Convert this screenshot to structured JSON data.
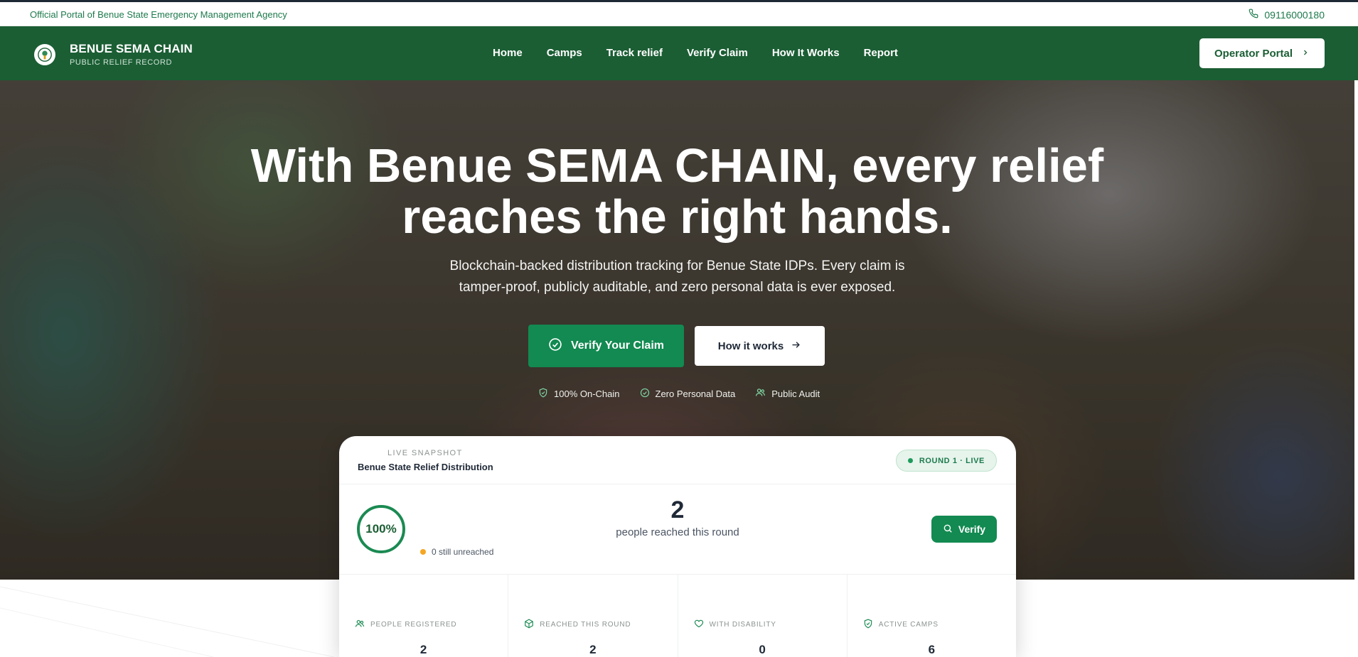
{
  "topbar": {
    "official_text": "Official Portal of Benue State Emergency Management Agency",
    "phone": "09116000180"
  },
  "brand": {
    "title": "BENUE SEMA CHAIN",
    "subtitle": "PUBLIC RELIEF RECORD"
  },
  "nav": {
    "items": [
      "Home",
      "Camps",
      "Track relief",
      "Verify Claim",
      "How It Works",
      "Report"
    ],
    "operator_label": "Operator Portal"
  },
  "hero": {
    "title_line1": "With Benue SEMA CHAIN, every relief",
    "title_line2": "reaches the right hands.",
    "subtitle": "Blockchain-backed distribution tracking for Benue State IDPs. Every claim is tamper-proof, publicly auditable, and zero personal data is ever exposed.",
    "primary_cta": "Verify Your Claim",
    "secondary_cta": "How it works",
    "badges": [
      "100% On-Chain",
      "Zero Personal Data",
      "Public Audit"
    ]
  },
  "snapshot": {
    "label": "LIVE SNAPSHOT",
    "title": "Benue State Relief Distribution",
    "round_status": "ROUND 1 · LIVE",
    "percent_reached": "100%",
    "unreached_text": "0 still unreached",
    "reached_count": "2",
    "reached_caption": "people reached this round",
    "verify_label": "Verify"
  },
  "stats": [
    {
      "icon": "people-icon",
      "label": "PEOPLE REGISTERED",
      "value": "2"
    },
    {
      "icon": "box-icon",
      "label": "REACHED THIS ROUND",
      "value": "2"
    },
    {
      "icon": "heart-icon",
      "label": "WITH DISABILITY",
      "value": "0"
    },
    {
      "icon": "shield-icon",
      "label": "ACTIVE CAMPS",
      "value": "6"
    }
  ],
  "colors": {
    "brand_green": "#1b5e34",
    "accent_green": "#128a51",
    "warning_orange": "#f5a623"
  }
}
